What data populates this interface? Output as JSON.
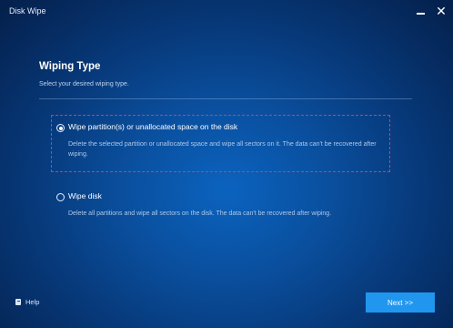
{
  "window": {
    "title": "Disk Wipe"
  },
  "page": {
    "heading": "Wiping Type",
    "subheading": "Select your desired wiping type."
  },
  "options": [
    {
      "label": "Wipe partition(s) or unallocated space on the disk",
      "description": "Delete the selected partition or unallocated space and wipe all sectors on it. The data can't be recovered after wiping.",
      "selected": true
    },
    {
      "label": "Wipe disk",
      "description": "Delete all partitions and wipe all sectors on the disk. The data can't be recovered after wiping.",
      "selected": false
    }
  ],
  "footer": {
    "help_label": "Help",
    "next_label": "Next >>"
  },
  "icons": {
    "minimize": "minimize-icon",
    "close": "close-icon",
    "help": "help-book-icon"
  },
  "colors": {
    "accent": "#2196ee",
    "highlight": "#e33b3b"
  }
}
